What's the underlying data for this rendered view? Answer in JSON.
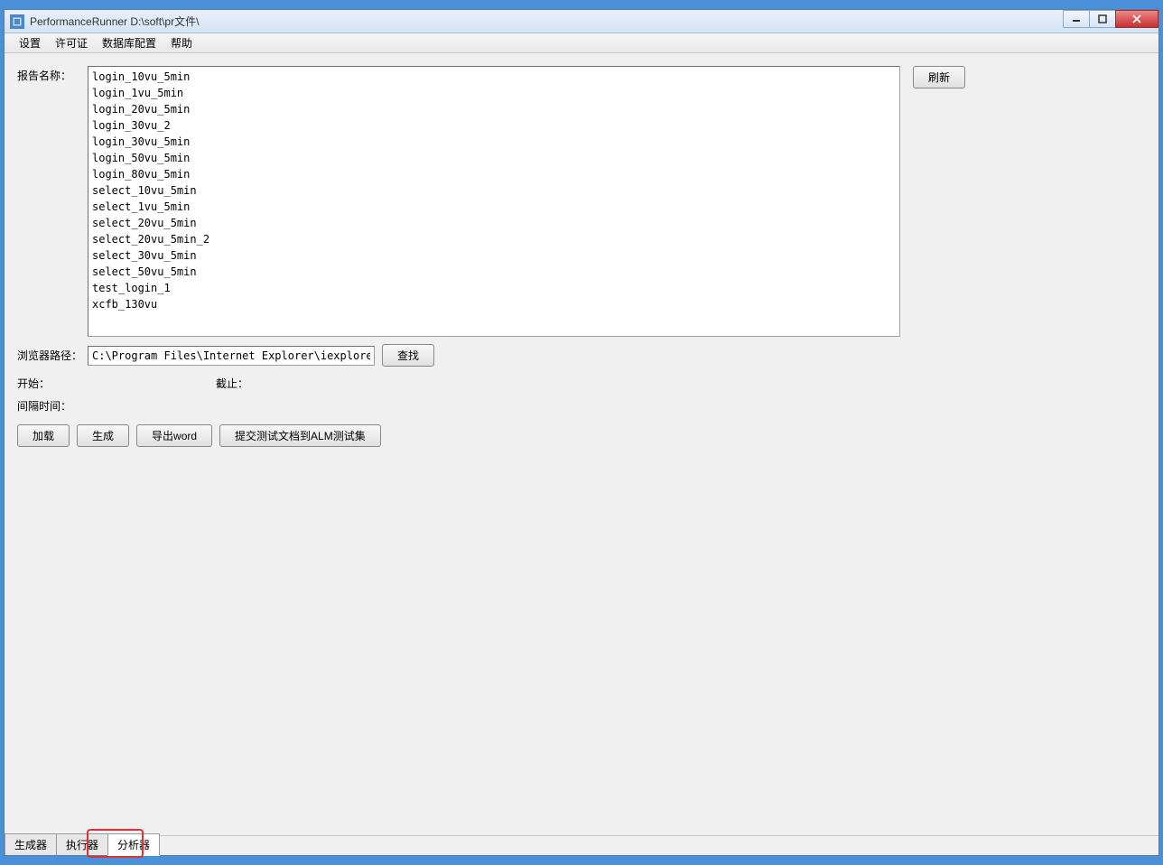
{
  "window": {
    "title": "PerformanceRunner  D:\\soft\\pr文件\\"
  },
  "menubar": {
    "items": [
      "设置",
      "许可证",
      "数据库配置",
      "帮助"
    ]
  },
  "labels": {
    "report_name": "报告名称：",
    "browser_path": "浏览器路径：",
    "start": "开始：",
    "end": "截止：",
    "interval": "间隔时间："
  },
  "report_list": [
    "login_10vu_5min",
    "login_1vu_5min",
    "login_20vu_5min",
    "login_30vu_2",
    "login_30vu_5min",
    "login_50vu_5min",
    "login_80vu_5min",
    "select_10vu_5min",
    "select_1vu_5min",
    "select_20vu_5min",
    "select_20vu_5min_2",
    "select_30vu_5min",
    "select_50vu_5min",
    "test_login_1",
    "xcfb_130vu"
  ],
  "browser_path_value": "C:\\Program Files\\Internet Explorer\\iexplore.exe",
  "buttons": {
    "refresh": "刷新",
    "find": "查找",
    "load": "加载",
    "generate": "生成",
    "export_word": "导出word",
    "submit_alm": "提交测试文档到ALM测试集"
  },
  "bottom_tabs": {
    "items": [
      "生成器",
      "执行器",
      "分析器"
    ],
    "active_index": 2
  }
}
